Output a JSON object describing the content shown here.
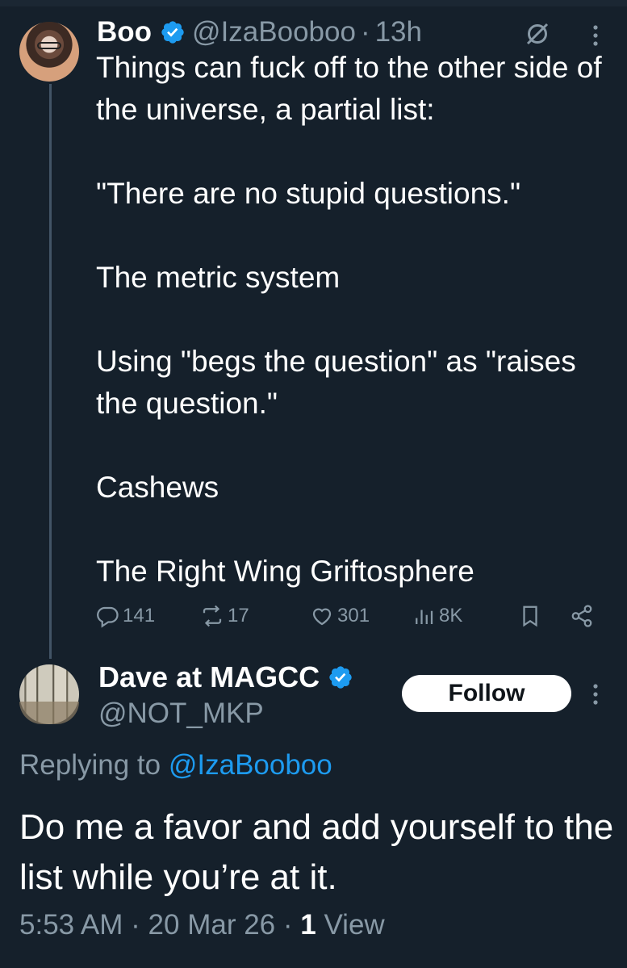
{
  "tweet": {
    "author_name": "Boo",
    "author_handle": "@IzaBooboo",
    "separator": "·",
    "time_ago": "13h",
    "body": [
      "Things can fuck off to the other side of the universe, a partial list:",
      "\"There are no stupid questions.\"",
      "The metric system",
      "Using \"begs the question\" as \"raises the question.\"",
      "Cashews",
      "The Right Wing Griftosphere"
    ],
    "actions": {
      "replies": "141",
      "reposts": "17",
      "likes": "301",
      "views": "8K"
    },
    "icons": [
      "verified-icon",
      "grok-icon",
      "more-icon",
      "reply-icon",
      "repost-icon",
      "like-icon",
      "views-icon",
      "bookmark-icon",
      "share-icon"
    ]
  },
  "reply": {
    "author_name": "Dave at MAGCC",
    "author_handle": "@NOT_MKP",
    "follow_label": "Follow",
    "replying_prefix": "Replying to",
    "replying_mention": "@IzaBooboo",
    "body": "Do me a favor and add yourself to the list while you’re at it.",
    "time": "5:53 AM",
    "date": "20 Mar 26",
    "view_count": "1",
    "view_label": "View",
    "separator": "·"
  },
  "colors": {
    "background": "#15202b",
    "secondary_text": "#8899a6",
    "accent": "#1d9bf0",
    "thread_line": "#425466"
  }
}
